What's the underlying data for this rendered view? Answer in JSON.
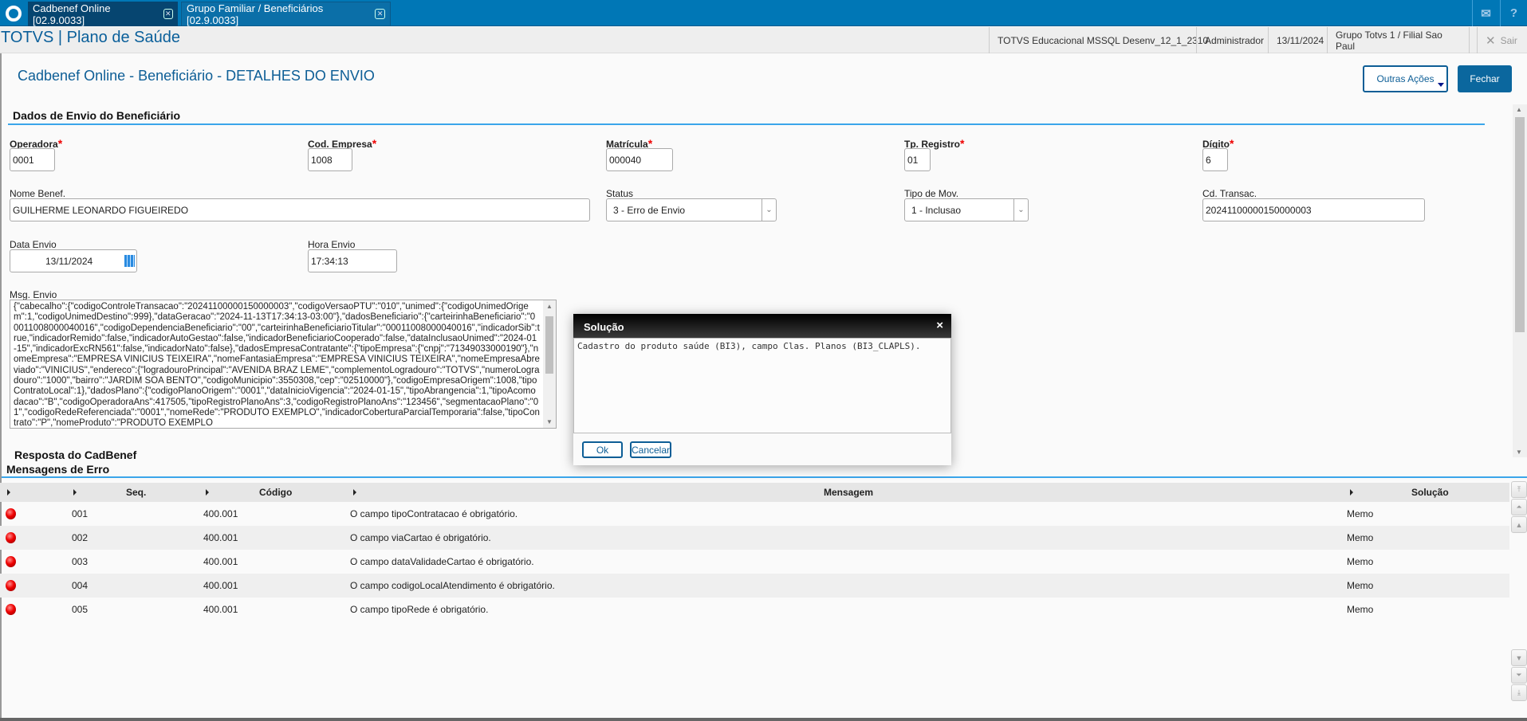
{
  "tabs": [
    {
      "label": "Cadbenef Online [02.9.0033]",
      "active": true
    },
    {
      "label": "Grupo Familiar / Beneficiários [02.9.0033]",
      "active": false
    }
  ],
  "top_icons": [
    "mail-icon",
    "help-icon"
  ],
  "header": {
    "app_title": "TOTVS | Plano de Saúde",
    "environment": "TOTVS Educacional MSSQL Desenv_12_1_2310",
    "user": "Administrador",
    "date": "13/11/2024",
    "branch": "Grupo Totvs 1 / Filial Sao Paul",
    "logout": "Sair"
  },
  "page": {
    "title": "Cadbenef Online - Beneficiário - DETALHES DO ENVIO",
    "actions_label": "Outras Ações",
    "close_label": "Fechar"
  },
  "form": {
    "section_title": "Dados de Envio do Beneficiário",
    "operadora": {
      "label": "Operadora",
      "value": "0001"
    },
    "cod_empresa": {
      "label": "Cod. Empresa",
      "value": "1008"
    },
    "matricula": {
      "label": "Matrícula",
      "value": "000040"
    },
    "tp_registro": {
      "label": "Tp. Registro",
      "value": "01"
    },
    "digito": {
      "label": "Dígito",
      "value": "6"
    },
    "nome": {
      "label": "Nome Benef.",
      "value": "GUILHERME LEONARDO FIGUEIREDO"
    },
    "status": {
      "label": "Status",
      "value": "3 - Erro de Envio"
    },
    "tipo_mov": {
      "label": "Tipo de Mov.",
      "value": "1 - Inclusao"
    },
    "cd_transac": {
      "label": "Cd. Transac.",
      "value": "20241100000150000003"
    },
    "data_envio": {
      "label": "Data Envio",
      "value": "13/11/2024"
    },
    "hora_envio": {
      "label": "Hora Envio",
      "value": "17:34:13"
    },
    "msg_envio": {
      "label": "Msg. Envio",
      "value": "{\"cabecalho\":{\"codigoControleTransacao\":\"20241100000150000003\",\"codigoVersaoPTU\":\"010\",\"unimed\":{\"codigoUnimedOrigem\":1,\"codigoUnimedDestino\":999},\"dataGeracao\":\"2024-11-13T17:34:13-03:00\"},\"dadosBeneficiario\":{\"carteirinhaBeneficiario\":\"00011008000040016\",\"codigoDependenciaBeneficiario\":\"00\",\"carteirinhaBeneficiarioTitular\":\"00011008000040016\",\"indicadorSib\":true,\"indicadorRemido\":false,\"indicadorAutoGestao\":false,\"indicadorBeneficiarioCooperado\":false,\"dataInclusaoUnimed\":\"2024-01-15\",\"indicadorExcRN561\":false,\"indicadorNato\":false},\"dadosEmpresaContratante\":{\"tipoEmpresa\":{\"cnpj\":\"71349033000190\"},\"nomeEmpresa\":\"EMPRESA VINICIUS TEIXEIRA\",\"nomeFantasiaEmpresa\":\"EMPRESA VINICIUS TEIXEIRA\",\"nomeEmpresaAbreviado\":\"VINICIUS\",\"endereco\":{\"logradouroPrincipal\":\"AVENIDA BRAZ LEME\",\"complementoLogradouro\":\"TOTVS\",\"numeroLogradouro\":\"1000\",\"bairro\":\"JARDIM SOA BENTO\",\"codigoMunicipio\":3550308,\"cep\":\"02510000\"},\"codigoEmpresaOrigem\":1008,\"tipoContratoLocal\":1},\"dadosPlano\":{\"codigoPlanoOrigem\":\"0001\",\"dataInicioVigencia\":\"2024-01-15\",\"tipoAbrangencia\":1,\"tipoAcomodacao\":\"B\",\"codigoOperadoraAns\":417505,\"tipoRegistroPlanoAns\":3,\"codigoRegistroPlanoAns\":\"123456\",\"segmentacaoPlano\":\"01\",\"codigoRedeReferenciada\":\"0001\",\"nomeRede\":\"PRODUTO EXEMPLO\",\"indicadorCoberturaParcialTemporaria\":false,\"tipoContrato\":\"P\",\"nomeProduto\":\"PRODUTO EXEMPLO"
    }
  },
  "response": {
    "section_title": "Resposta do CadBenef",
    "grid_title": "Mensagens de Erro",
    "columns": [
      "Seq.",
      "Código",
      "Mensagem",
      "Solução"
    ],
    "rows": [
      {
        "status": "error",
        "seq": "001",
        "codigo": "400.001",
        "mensagem": "O campo tipoContratacao é obrigatório.",
        "solucao": "Memo"
      },
      {
        "status": "error",
        "seq": "002",
        "codigo": "400.001",
        "mensagem": "O campo viaCartao é obrigatório.",
        "solucao": "Memo"
      },
      {
        "status": "error",
        "seq": "003",
        "codigo": "400.001",
        "mensagem": "O campo dataValidadeCartao é obrigatório.",
        "solucao": "Memo"
      },
      {
        "status": "error",
        "seq": "004",
        "codigo": "400.001",
        "mensagem": "O campo codigoLocalAtendimento é obrigatório.",
        "solucao": "Memo"
      },
      {
        "status": "error",
        "seq": "005",
        "codigo": "400.001",
        "mensagem": "O campo tipoRede é obrigatório.",
        "solucao": "Memo"
      }
    ]
  },
  "dialog": {
    "title": "Solução",
    "text": "Cadastro do produto saúde (BI3), campo Clas. Planos (BI3_CLAPLS).",
    "ok_label": "Ok",
    "cancel_label": "Cancelar"
  },
  "colors": {
    "brand": "#0077b6",
    "accent": "#0d5e96",
    "section_line": "#3aa5ea",
    "error": "#e00000"
  }
}
